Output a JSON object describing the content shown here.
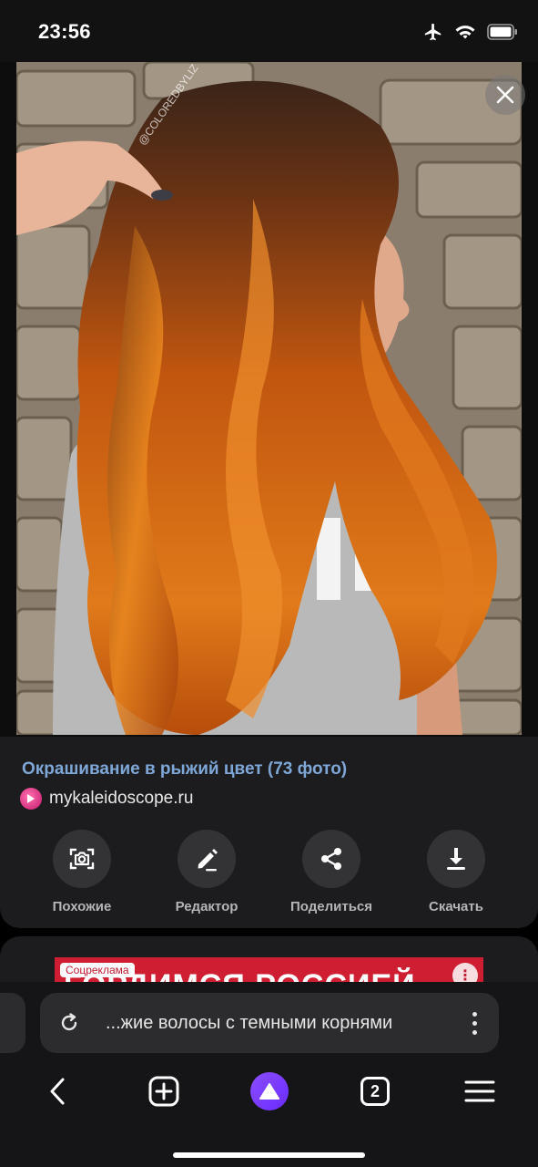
{
  "status_bar": {
    "time": "23:56",
    "icons": [
      "airplane-icon",
      "wifi-icon",
      "battery-icon"
    ]
  },
  "viewer": {
    "photo_watermark": "@COLOREDBYLIZ",
    "shirt_text": "PIN",
    "close_icon": "close-icon"
  },
  "info": {
    "title": "Окрашивание в рыжий цвет (73 фото)",
    "source": "mykaleidoscope.ru",
    "actions": [
      {
        "label": "Похожие",
        "icon": "camera-search-icon"
      },
      {
        "label": "Редактор",
        "icon": "pencil-icon"
      },
      {
        "label": "Поделиться",
        "icon": "share-icon"
      },
      {
        "label": "Скачать",
        "icon": "download-icon"
      }
    ]
  },
  "ad": {
    "badge": "Соцреклама",
    "headline": "ГОРДИМСЯ РОССИЕЙ"
  },
  "browser": {
    "address_text": "...жие волосы с темными корнями",
    "tab_count": "2"
  },
  "colors": {
    "title_link": "#7ea7d8",
    "card_bg": "#1c1c1e",
    "ad_red": "#cf1d32",
    "alice_purple": "#7a3cff"
  }
}
